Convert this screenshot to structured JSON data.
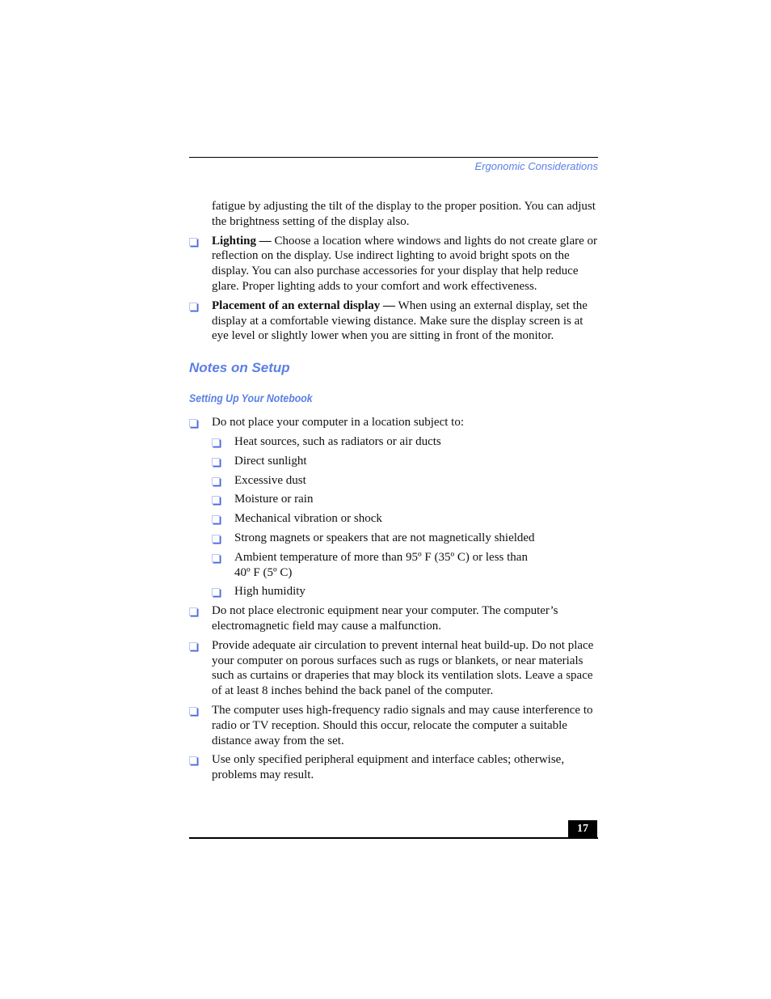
{
  "header": {
    "running_title": "Ergonomic Considerations"
  },
  "intro_paragraph": "fatigue by adjusting the tilt of the display to the proper position. You can adjust the brightness setting of the display also.",
  "ergonomic_items": [
    {
      "term": "Lighting —",
      "text": " Choose a location where windows and lights do not create glare or reflection on the display. Use indirect lighting to avoid bright spots on the display. You can also purchase accessories for your display that help reduce glare. Proper lighting adds to your comfort and work effectiveness."
    },
    {
      "term": "Placement of an external display —",
      "text": " When using an external display, set the display at a comfortable viewing distance. Make sure the display screen is at eye level or slightly lower when you are sitting in front of the monitor."
    }
  ],
  "section_title": "Notes on Setup",
  "subsection_title": "Setting Up Your Notebook",
  "setup_items": [
    {
      "text": "Do not place your computer in a location subject to:"
    }
  ],
  "location_subitems": [
    "Heat sources, such as radiators or air ducts",
    "Direct sunlight",
    "Excessive dust",
    "Moisture or rain",
    "Mechanical vibration or shock",
    "Strong magnets or speakers that are not magnetically shielded",
    "Ambient temperature of more than 95º F (35º C) or less than 40º F (5º C)",
    "High humidity"
  ],
  "setup_items_after": [
    "Do not place electronic equipment near your computer. The computer’s electromagnetic field may cause a malfunction.",
    "Provide adequate air circulation to prevent internal heat build-up. Do not place your computer on porous surfaces such as rugs or blankets, or near materials such as curtains or draperies that may block its ventilation slots. Leave a space of at least 8 inches behind the back panel of the computer.",
    "The computer uses high-frequency radio signals and may cause interference to radio or TV reception. Should this occur, relocate the computer a suitable distance away from the set.",
    "Use only specified peripheral equipment and interface cables; otherwise, problems may result."
  ],
  "footer": {
    "page_number": "17"
  },
  "colors": {
    "accent": "#5b7fe6",
    "text": "#111111",
    "rule": "#000000"
  }
}
